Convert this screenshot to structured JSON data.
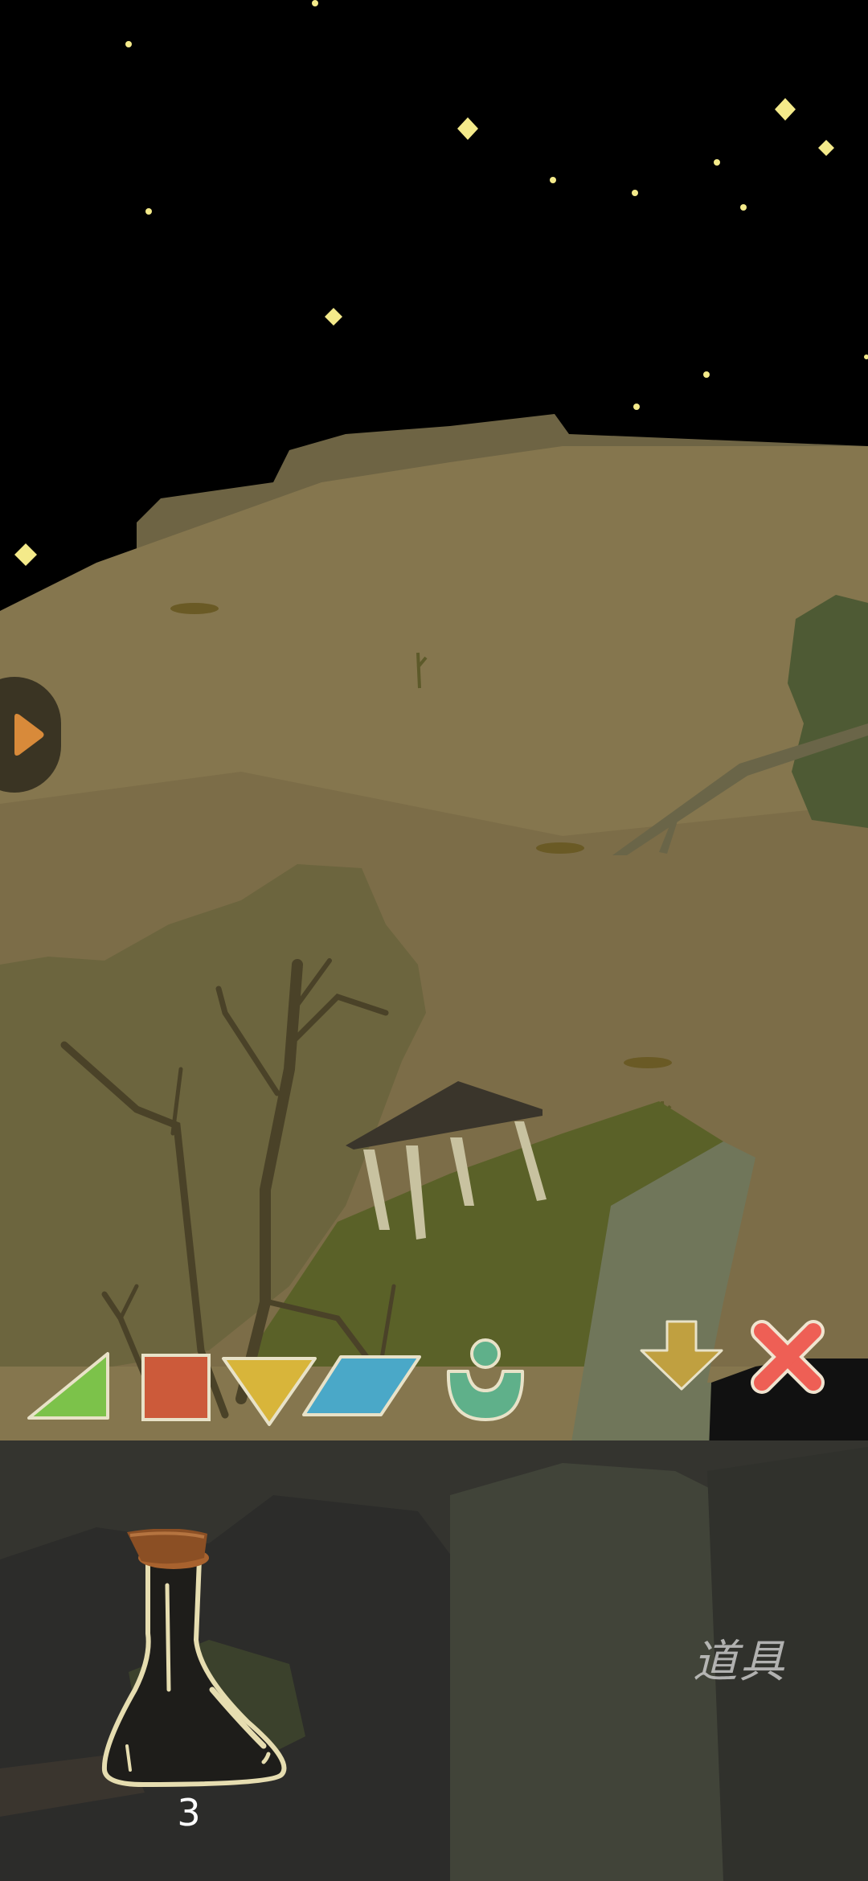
{
  "scene": {
    "sky_color": "#000000",
    "ground_color": "#85764e",
    "star_color": "#f4ea8a",
    "nav_arrow_color": "#d88a3a"
  },
  "shape_buttons": [
    {
      "name": "triangle",
      "icon": "green-triangle",
      "color": "#7cc24a"
    },
    {
      "name": "square",
      "icon": "red-square",
      "color": "#cc5a3a"
    },
    {
      "name": "down-triangle",
      "icon": "yellow-inverted-triangle",
      "color": "#d8b53a"
    },
    {
      "name": "parallelogram",
      "icon": "blue-parallelogram",
      "color": "#4aa8c8"
    },
    {
      "name": "figure",
      "icon": "teal-figure",
      "color": "#5fb08a"
    }
  ],
  "controls": {
    "confirm_icon": "down-arrow",
    "confirm_color": "#c0a040",
    "cancel_icon": "close-x",
    "cancel_color": "#ee5f55"
  },
  "inventory": {
    "item_icon": "flask-bottle",
    "item_count": "3",
    "label": "道具"
  }
}
